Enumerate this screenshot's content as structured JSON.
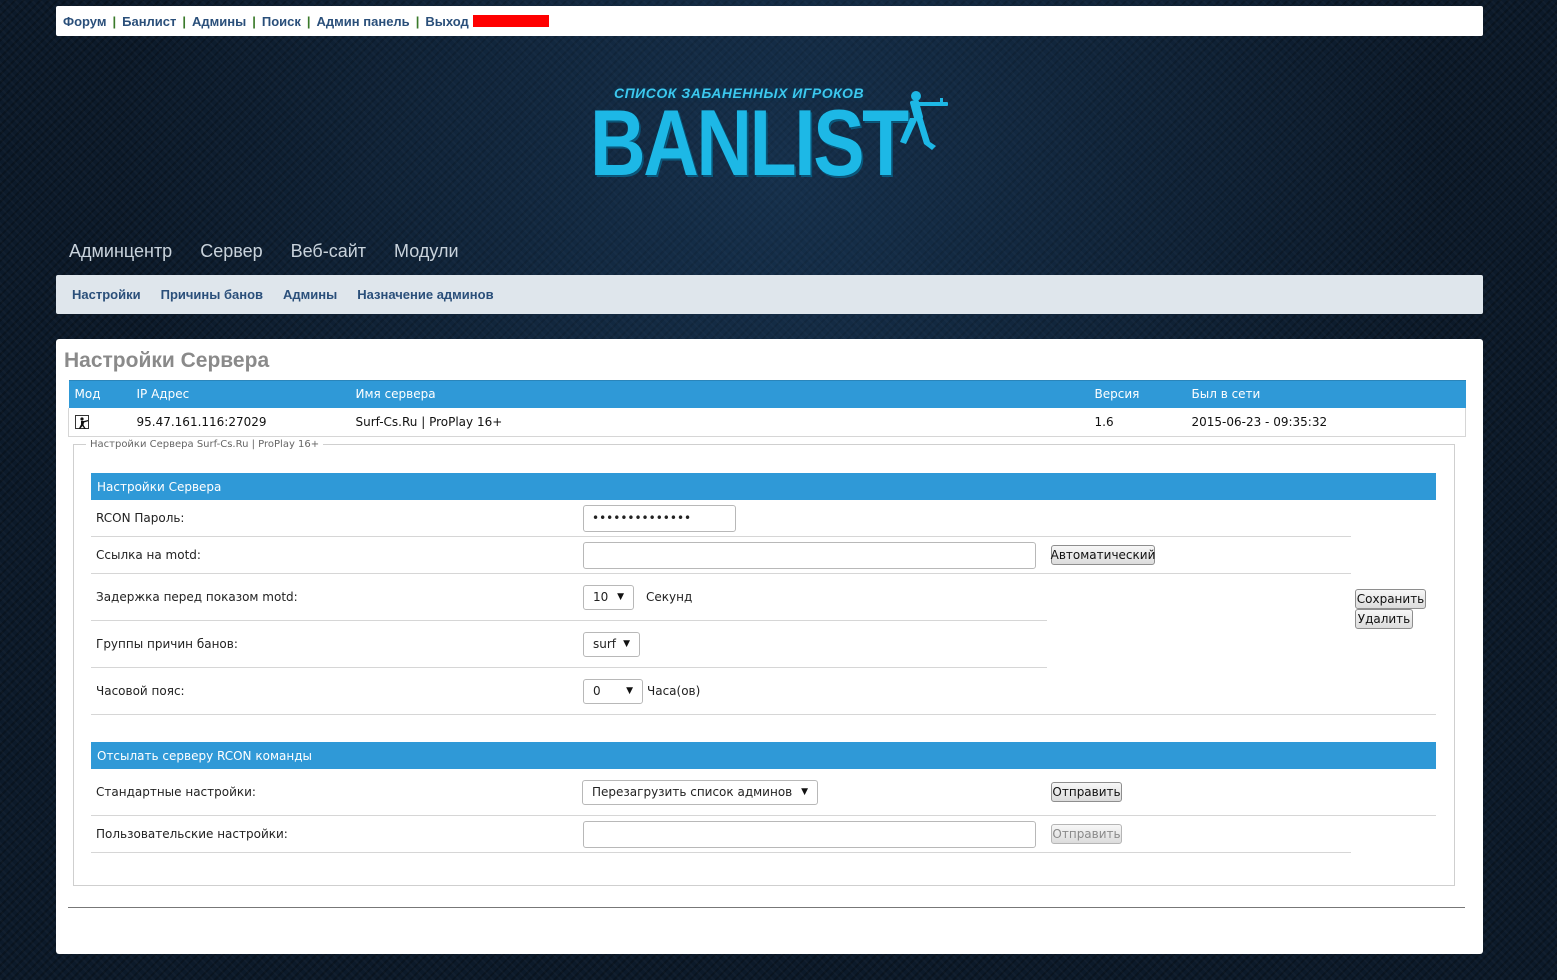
{
  "topbar": {
    "links": [
      "Форум",
      "Банлист",
      "Админы",
      "Поиск",
      "Админ панель",
      "Выход"
    ],
    "separator": "|"
  },
  "logo": {
    "subtitle": "СПИСОК ЗАБАНЕННЫХ ИГРОКОВ",
    "title": "BANLIST"
  },
  "main_nav": [
    "Админцентр",
    "Сервер",
    "Веб-сайт",
    "Модули"
  ],
  "sub_nav": [
    "Настройки",
    "Причины банов",
    "Админы",
    "Назначение админов"
  ],
  "page_title": "Настройки Сервера",
  "server_table": {
    "headers": [
      "Мод",
      "IP Адрес",
      "Имя сервера",
      "Версия",
      "Был в сети"
    ],
    "row": {
      "ip": "95.47.161.116:27029",
      "name": "Surf-Cs.Ru | ProPlay 16+",
      "version": "1.6",
      "last_seen": "2015-06-23 - 09:35:32"
    }
  },
  "settings": {
    "legend": "Настройки Сервера Surf-Cs.Ru | ProPlay 16+",
    "section1_title": "Настройки Сервера",
    "rcon_label": "RCON Пароль:",
    "rcon_value": "••••••••••••••",
    "motd_label": "Ссылка на motd:",
    "motd_value": "",
    "auto_button": "Автоматический",
    "delay_label": "Задержка перед показом motd:",
    "delay_value": "10",
    "delay_unit": "Секунд",
    "groups_label": "Группы причин банов:",
    "groups_value": "surf",
    "tz_label": "Часовой пояс:",
    "tz_value": "0",
    "tz_unit": "Часа(ов)",
    "save_button": "Сохранить",
    "delete_button": "Удалить",
    "section2_title": "Отсылать серверу RCON команды",
    "std_label": "Стандартные настройки:",
    "std_value": "Перезагрузить список админов",
    "send_button": "Отправить",
    "custom_label": "Пользовательские настройки:",
    "custom_value": "",
    "send_button_disabled": "Отправить"
  }
}
